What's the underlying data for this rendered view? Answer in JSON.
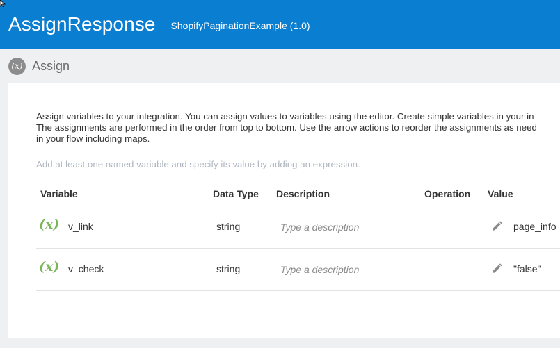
{
  "header": {
    "title": "AssignResponse",
    "subtitle": "ShopifyPaginationExample (1.0)"
  },
  "section": {
    "icon": "variable-icon",
    "badge_text": "(x)",
    "label": "Assign"
  },
  "description": {
    "line1": "Assign variables to your integration. You can assign values to variables using the editor. Create simple variables in your in",
    "line2": "The assignments are performed in the order from top to bottom. Use the arrow actions to reorder the assignments as need",
    "line3": "in your flow including maps."
  },
  "hint": "Add at least one named variable and specify its value by adding an expression.",
  "table": {
    "columns": [
      "Variable",
      "Data Type",
      "Description",
      "Operation",
      "Value"
    ],
    "rows": [
      {
        "icon_text": "(x)",
        "variable": "v_link",
        "data_type": "string",
        "description_placeholder": "Type a description",
        "operation": "",
        "value": "page_info"
      },
      {
        "icon_text": "(x)",
        "variable": "v_check",
        "data_type": "string",
        "description_placeholder": "Type a description",
        "operation": "",
        "value": "\"false\""
      }
    ]
  },
  "colors": {
    "header_bg": "#0a7ed1",
    "variable_icon": "#7ab55c",
    "page_bg": "#eef0f2"
  }
}
